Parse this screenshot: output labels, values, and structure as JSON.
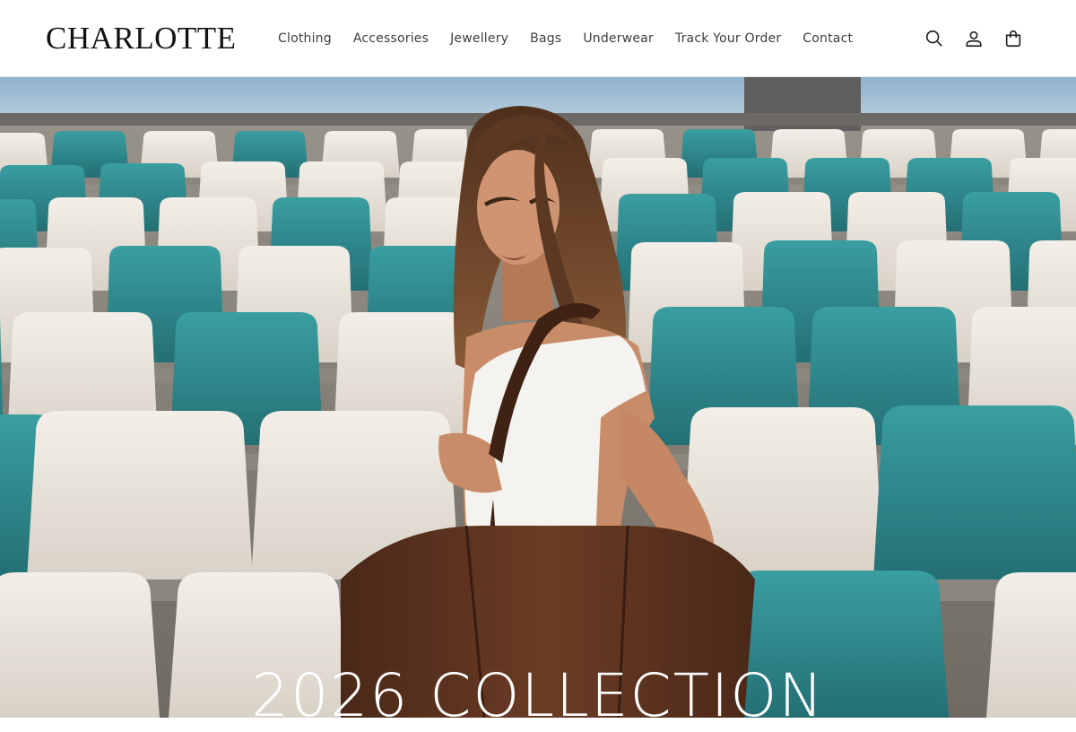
{
  "header": {
    "logo": "CHARLOTTE",
    "nav": [
      {
        "label": "Clothing"
      },
      {
        "label": "Accessories"
      },
      {
        "label": "Jewellery"
      },
      {
        "label": "Bags"
      },
      {
        "label": "Underwear"
      },
      {
        "label": "Track Your Order"
      },
      {
        "label": "Contact"
      }
    ],
    "icons": [
      "search-icon",
      "account-icon",
      "cart-icon"
    ]
  },
  "hero": {
    "title": "2026 COLLECTION",
    "colors": {
      "sky": "#9fbcd4",
      "seat_white": "#ece7df",
      "seat_teal": "#2f8f93",
      "bag": "#5a3322",
      "skin": "#c98c68",
      "hair": "#5b3a24"
    }
  }
}
